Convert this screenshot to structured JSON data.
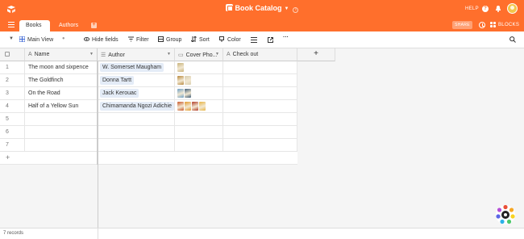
{
  "header": {
    "base_title": "Book Catalog",
    "help_label": "HELP",
    "icons": [
      "airtable-logo-icon",
      "base-icon",
      "info-icon",
      "help-icon",
      "bell-icon",
      "avatar"
    ],
    "accent_color": "#ff6f2c"
  },
  "tabs": {
    "items": [
      {
        "label": "Books",
        "active": true
      },
      {
        "label": "Authors",
        "active": false
      }
    ],
    "share_label": "SHARE",
    "blocks_label": "BLOCKS"
  },
  "viewbar": {
    "view_name": "Main View",
    "hide_fields": "Hide fields",
    "filter": "Filter",
    "group": "Group",
    "sort": "Sort",
    "color": "Color",
    "more": "···"
  },
  "columns": [
    {
      "label": "Name",
      "type_icon": "A"
    },
    {
      "label": "Author",
      "type_icon": "☰"
    },
    {
      "label": "Cover Pho...",
      "type_icon": "📄"
    },
    {
      "label": "Check out",
      "type_icon": "A"
    }
  ],
  "add_column": "+",
  "rows": [
    {
      "num": "1",
      "name": "The moon and sixpence",
      "author": "W. Somerset Maugham",
      "covers": [
        "#c8b27a"
      ],
      "check_out": ""
    },
    {
      "num": "2",
      "name": "The Goldfinch",
      "author": "Donna Tartt",
      "covers": [
        "#b8893e",
        "#d9cfb0"
      ],
      "check_out": ""
    },
    {
      "num": "3",
      "name": "On the Road",
      "author": "Jack Kerouac",
      "covers": [
        "#6e9fc4",
        "#3c5b76"
      ],
      "check_out": ""
    },
    {
      "num": "4",
      "name": "Half of a Yellow Sun",
      "author": "Chimamanda Ngozi Adichie",
      "covers": [
        "#c9582a",
        "#e39a2d",
        "#b03b27",
        "#e8b545"
      ],
      "check_out": ""
    },
    {
      "num": "5",
      "name": "",
      "author": "",
      "covers": [],
      "check_out": ""
    },
    {
      "num": "6",
      "name": "",
      "author": "",
      "covers": [],
      "check_out": ""
    },
    {
      "num": "7",
      "name": "",
      "author": "",
      "covers": [],
      "check_out": ""
    }
  ],
  "add_row": "+",
  "footer": {
    "records": "7 records"
  }
}
